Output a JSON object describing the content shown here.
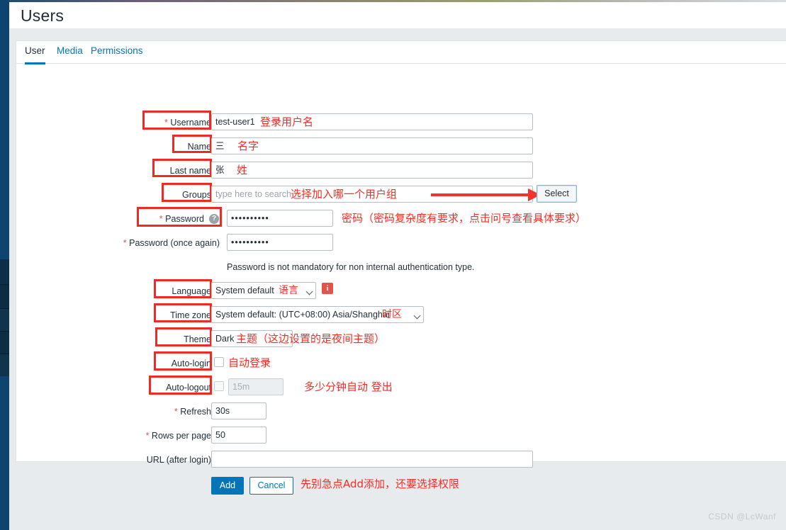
{
  "app": {
    "page_title": "Users",
    "watermark": "CSDN @LcWanf"
  },
  "tabs": [
    {
      "label": "User",
      "active": true
    },
    {
      "label": "Media",
      "active": false
    },
    {
      "label": "Permissions",
      "active": false
    }
  ],
  "form": {
    "username": {
      "label": "Username",
      "required_marker": "*",
      "value": "test-user1",
      "annotation": "登录用户名"
    },
    "name": {
      "label": "Name",
      "value": "三",
      "annotation": "名字"
    },
    "last_name": {
      "label": "Last name",
      "value": "张",
      "annotation": "姓"
    },
    "groups": {
      "label": "Groups",
      "placeholder": "type here to search",
      "value": "",
      "annotation": "选择加入哪一个用户组",
      "select_button": "Select"
    },
    "password": {
      "label": "Password",
      "required_marker": "*",
      "value": "••••••••••",
      "help_icon": "question-mark-icon",
      "annotation": "密码（密码复杂度有要求，点击问号查看具体要求）"
    },
    "password_again": {
      "label": "Password (once again)",
      "required_marker": "*",
      "value": "••••••••••"
    },
    "password_hint": "Password is not mandatory for non internal authentication type.",
    "language": {
      "label": "Language",
      "value": "System default",
      "annotation": "语言",
      "info_icon": "info-icon"
    },
    "time_zone": {
      "label": "Time zone",
      "value": "System default: (UTC+08:00) Asia/Shanghai",
      "annotation": "时区"
    },
    "theme": {
      "label": "Theme",
      "value": "Dark",
      "annotation": "主题（这边设置的是夜间主题）"
    },
    "auto_login": {
      "label": "Auto-login",
      "checked": false,
      "annotation": "自动登录"
    },
    "auto_logout": {
      "label": "Auto-logout",
      "checked": false,
      "value": "15m",
      "disabled": true,
      "annotation": "多少分钟自动 登出"
    },
    "refresh": {
      "label": "Refresh",
      "required_marker": "*",
      "value": "30s"
    },
    "rows_per_page": {
      "label": "Rows per page",
      "required_marker": "*",
      "value": "50"
    },
    "url_after_login": {
      "label": "URL (after login)",
      "value": ""
    }
  },
  "actions": {
    "add_label": "Add",
    "cancel_label": "Cancel",
    "annotation": "先别急点Add添加，还要选择权限"
  },
  "colors": {
    "accent": "#0275b8",
    "annotation_red": "#fb2b24",
    "sidebar": "#0d4570",
    "required": "#d9534f"
  }
}
